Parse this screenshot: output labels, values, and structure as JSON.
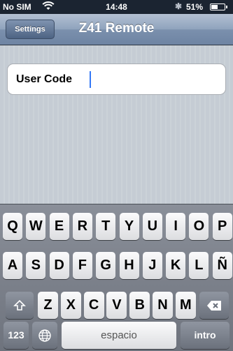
{
  "status_bar": {
    "carrier": "No SIM",
    "time": "14:48",
    "battery_text": "51%",
    "battery_level": 0.51
  },
  "nav": {
    "back_label": "Settings",
    "title": "Z41 Remote"
  },
  "form": {
    "user_code_label": "User Code",
    "user_code_value": ""
  },
  "keyboard": {
    "row1": [
      "Q",
      "W",
      "E",
      "R",
      "T",
      "Y",
      "U",
      "I",
      "O",
      "P"
    ],
    "row2": [
      "A",
      "S",
      "D",
      "F",
      "G",
      "H",
      "J",
      "K",
      "L",
      "Ñ"
    ],
    "row3": [
      "Z",
      "X",
      "C",
      "V",
      "B",
      "N",
      "M"
    ],
    "numbers_label": "123",
    "space_label": "espacio",
    "return_label": "intro",
    "icons": {
      "shift": "shift-icon",
      "backspace": "backspace-icon",
      "globe": "globe-icon"
    }
  },
  "colors": {
    "nav_gradient_top": "#b3c0d2",
    "nav_gradient_bottom": "#6e84a3",
    "caret": "#3478f6"
  }
}
